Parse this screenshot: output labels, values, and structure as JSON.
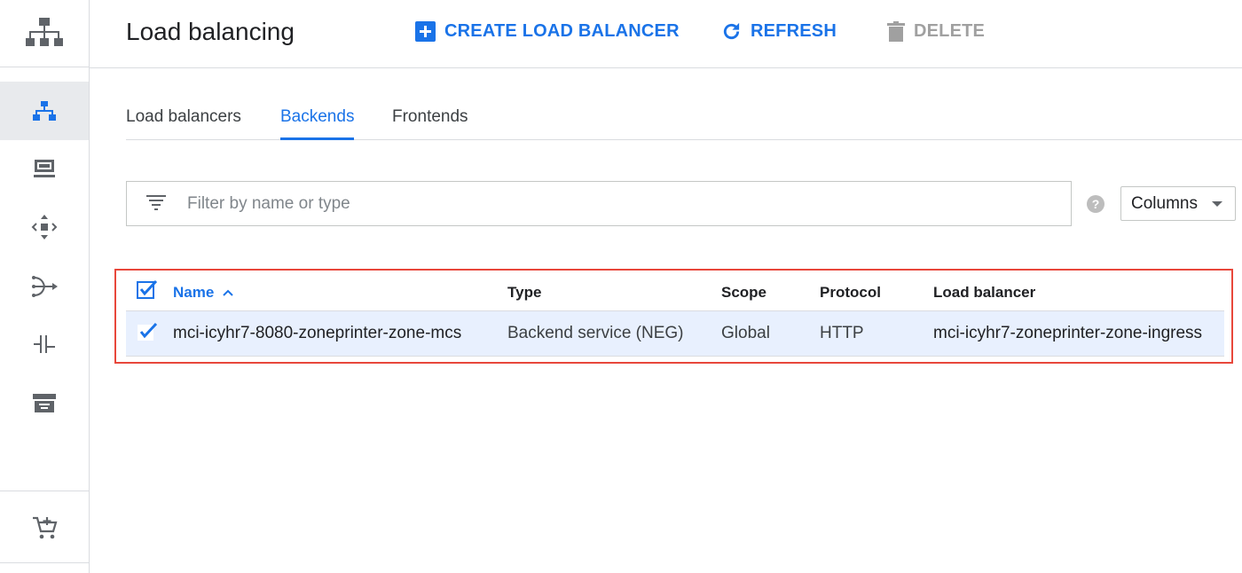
{
  "header": {
    "title": "Load balancing",
    "create_label": "CREATE LOAD BALANCER",
    "refresh_label": "REFRESH",
    "delete_label": "DELETE"
  },
  "sidebar": {
    "items": [
      {
        "icon": "network-tree-icon",
        "active": true
      },
      {
        "icon": "vm-instance-icon",
        "active": false
      },
      {
        "icon": "move-arrows-icon",
        "active": false
      },
      {
        "icon": "routing-icon",
        "active": false
      },
      {
        "icon": "interconnect-icon",
        "active": false
      },
      {
        "icon": "storage-icon",
        "active": false
      },
      {
        "icon": "marketplace-cart-icon",
        "active": false
      }
    ]
  },
  "tabs": [
    {
      "label": "Load balancers",
      "active": false
    },
    {
      "label": "Backends",
      "active": true
    },
    {
      "label": "Frontends",
      "active": false
    }
  ],
  "filter": {
    "placeholder": "Filter by name or type",
    "columns_label": "Columns"
  },
  "table": {
    "columns": [
      "Name",
      "Type",
      "Scope",
      "Protocol",
      "Load balancer"
    ],
    "sorted_column": "Name",
    "sort_direction": "ascending",
    "rows": [
      {
        "selected": true,
        "name": "mci-icyhr7-8080-zoneprinter-zone-mcs",
        "type": "Backend service (NEG)",
        "scope": "Global",
        "protocol": "HTTP",
        "load_balancer": "mci-icyhr7-zoneprinter-zone-ingress"
      }
    ]
  },
  "colors": {
    "accent": "#1a73e8",
    "highlight_border": "#e8473b",
    "selected_row": "#e8f0fe"
  }
}
